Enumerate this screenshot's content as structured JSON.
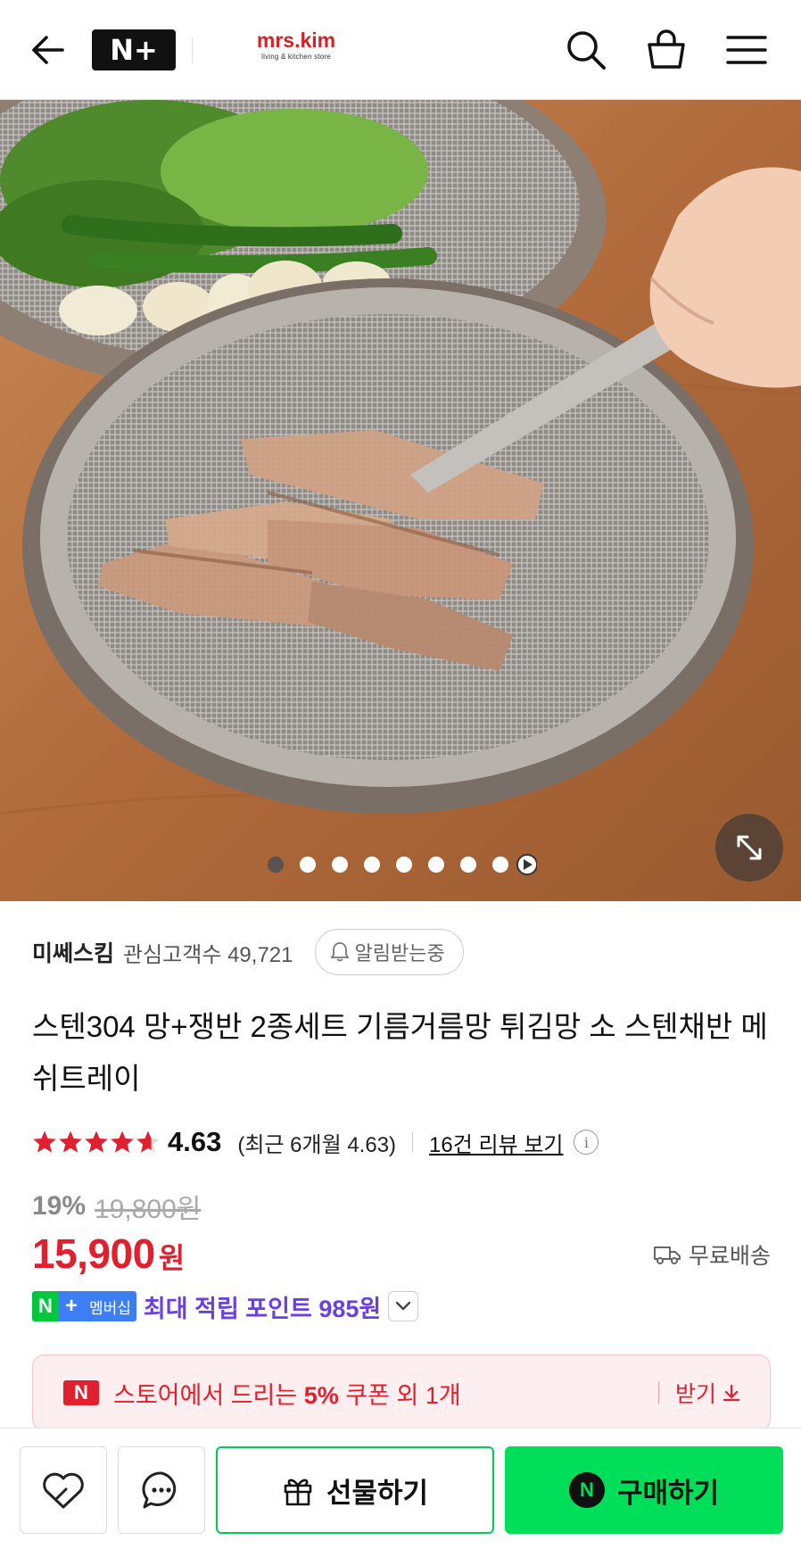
{
  "header": {
    "brand_badge": "N+",
    "store_logo_name": "mrs.kim",
    "store_logo_sub": "living & kitchen store"
  },
  "gallery": {
    "total_images": 8,
    "current_index": 1
  },
  "product": {
    "seller": "미쎄스킴",
    "fans_label": "관심고객수 49,721",
    "alarm_label": "알림받는중",
    "title": "스텐304 망+쟁반 2종세트 기름거름망 튀김망 소 스텐채반 메쉬트레이",
    "rating_value": 4.63,
    "rating_text": "4.63",
    "recent_rating": "(최근 6개월 4.63)",
    "review_link": "16건 리뷰 보기",
    "discount_rate": "19%",
    "original_price": "19,800원",
    "price": "15,900",
    "price_unit": "원",
    "shipping": "무료배송"
  },
  "membership": {
    "badge_n": "N",
    "badge_plus": "+",
    "badge_text": "멤버십",
    "text_prefix": "최대 적립 포인트",
    "points": "985",
    "unit": "원"
  },
  "coupon": {
    "icon_letter": "N",
    "text_before": "스토어에서 드리는",
    "percent": "5%",
    "text_after": "쿠폰 외 1개",
    "get_label": "받기"
  },
  "bottom_bar": {
    "gift_label": "선물하기",
    "buy_label": "구매하기",
    "buy_icon_letter": "N"
  },
  "colors": {
    "accent_red": "#e0202f",
    "naver_green": "#00de5a",
    "membership_purple": "#6b3fe0"
  }
}
